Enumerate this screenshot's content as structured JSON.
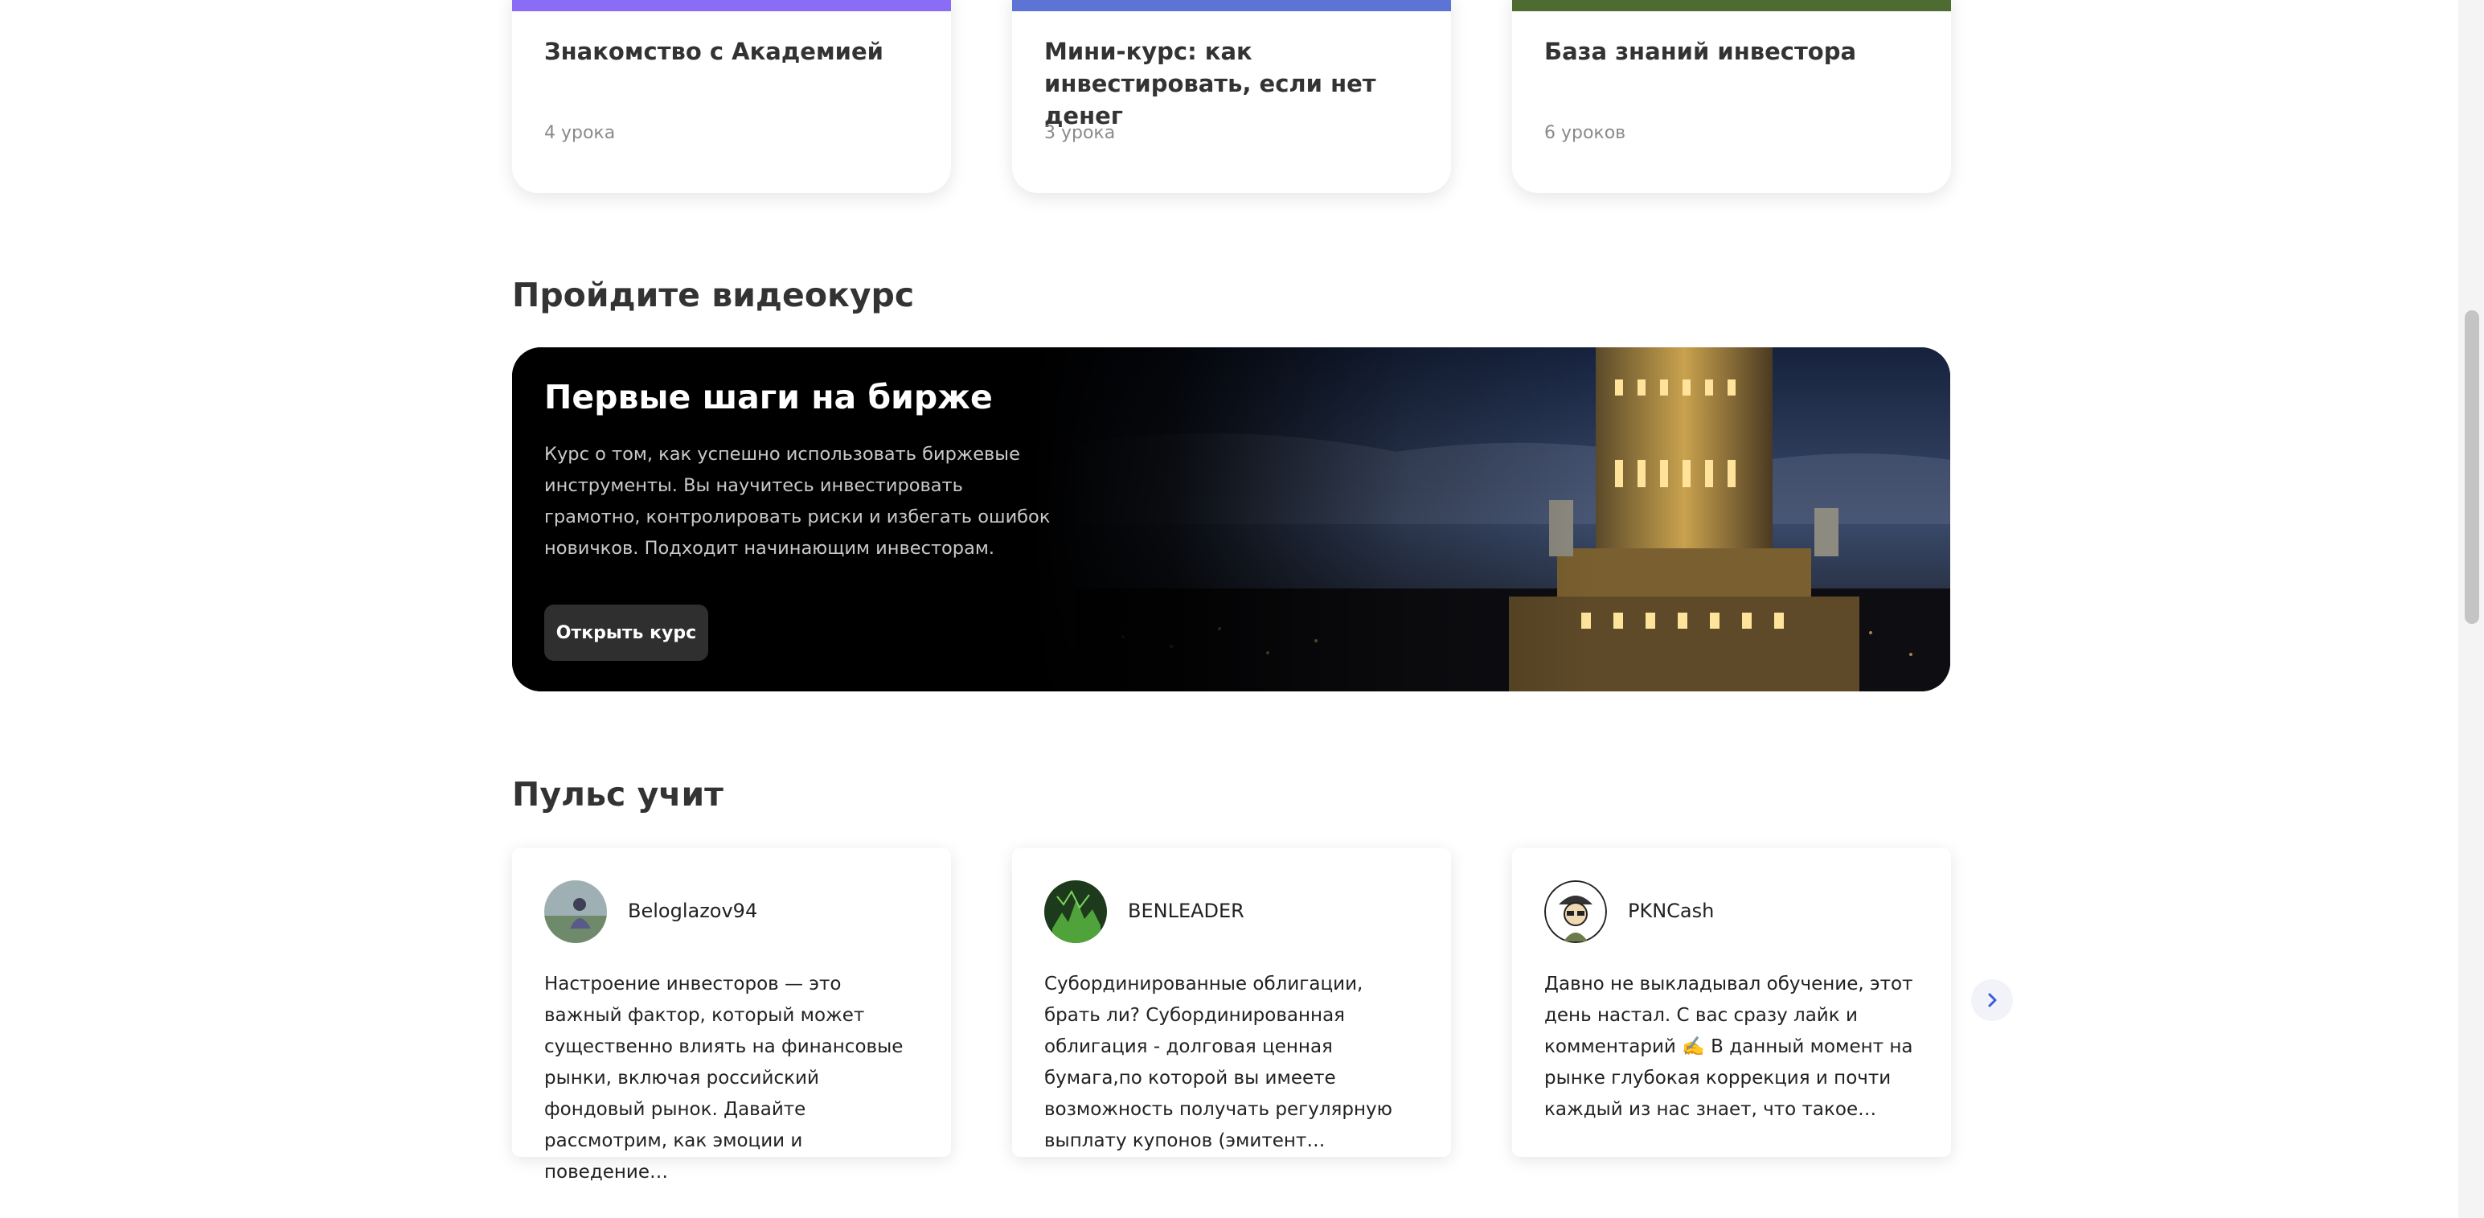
{
  "courses": [
    {
      "title": "Знакомство с Академией",
      "lessons": "4 урока",
      "color": "#8b6cf6"
    },
    {
      "title": "Мини-курс: как инвестировать, если нет денег",
      "lessons": "3 урока",
      "color": "#5b74d6"
    },
    {
      "title": "База знаний инвестора",
      "lessons": "6 уроков",
      "color": "#4e6b32"
    }
  ],
  "video_section": {
    "heading": "Пройдите видеокурс",
    "banner": {
      "title": "Первые шаги на бирже",
      "description": "Курс о том, как успешно использовать биржевые инструменты. Вы научитесь инвестировать грамотно, контролировать риски и избегать ошибок новичков. Подходит начинающим инвесторам.",
      "button": "Открыть курс"
    }
  },
  "pulse_section": {
    "heading": "Пульс учит",
    "posts": [
      {
        "author": "Beloglazov94",
        "text": "Настроение инвесторов — это важный фактор, который может существенно влиять на финансовые рынки, включая российский фондовый рынок. Давайте рассмотрим, как эмоции и поведение…"
      },
      {
        "author": "BENLEADER",
        "text": "Субординированные облигации, брать ли? Субординированная облигация - долговая ценная бумага,по которой вы имеете возможность получать регулярную выплату купонов (эмитент…"
      },
      {
        "author": "PKNCash",
        "text": "Давно не выкладывал обучение, этот день настал. С вас сразу лайк и комментарий ✍️ В данный момент на рынке глубокая коррекция и почти каждый из нас знает, что такое…"
      }
    ],
    "next_icon": "chevron-right-icon"
  },
  "colors": {
    "accent_blue": "#3b5bdb",
    "banner_bg": "#000000",
    "button_bg": "#2f2f2f"
  }
}
